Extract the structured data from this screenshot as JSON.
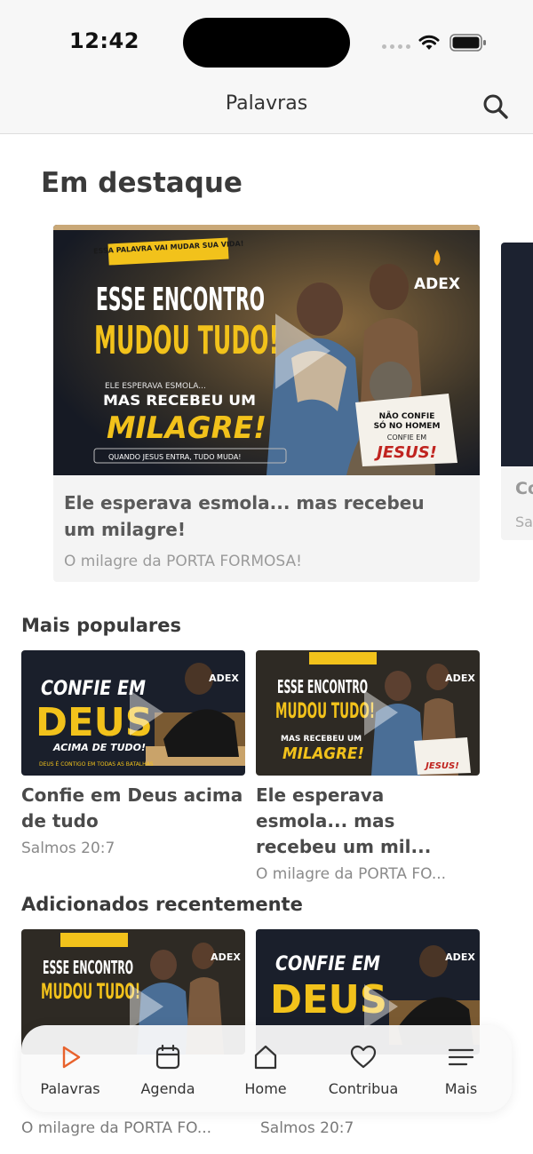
{
  "status": {
    "time": "12:42"
  },
  "header": {
    "title": "Palavras"
  },
  "featured": {
    "heading": "Em destaque",
    "item": {
      "title": "Ele esperava esmola... mas recebeu um milagre!",
      "subtitle": "O milagre da PORTA FORMOSA!"
    },
    "peek": {
      "title": "Co",
      "subtitle": "Sa"
    }
  },
  "popular": {
    "heading": "Mais populares",
    "items": [
      {
        "title": "Confie em Deus acima de tudo",
        "subtitle": "Salmos 20:7"
      },
      {
        "title": "Ele esperava esmola... mas recebeu um mil...",
        "subtitle": "O milagre da PORTA FO..."
      }
    ]
  },
  "recent": {
    "heading": "Adicionados recentemente",
    "items": [
      {
        "subtitle": "O milagre da PORTA FO..."
      },
      {
        "subtitle": "Salmos 20:7"
      }
    ]
  },
  "thumbs": {
    "milagre": {
      "banner": "ESSA PALAVRA VAI MUDAR SUA VIDA!",
      "line1": "ESSE ENCONTRO",
      "line2": "MUDOU TUDO!",
      "pre": "ELE ESPERAVA ESMOLA...",
      "mid": "MAS RECEBEU UM",
      "big": "MILAGRE!",
      "footer": "QUANDO JESUS ENTRA, TUDO MUDA!",
      "note1": "NÃO CONFIE",
      "note2": "SÓ NO HOMEM",
      "note3": "CONFIE EM",
      "note4": "JESUS!",
      "brand": "ADEX"
    },
    "confie": {
      "line1": "CONFIE EM",
      "line2": "DEUS",
      "line3": "ACIMA DE TUDO!",
      "footer": "DEUS É CONTIGO EM TODAS AS BATALHAS",
      "brand": "ADEX"
    }
  },
  "tabs": [
    {
      "label": "Palavras",
      "icon": "play-icon",
      "active": true
    },
    {
      "label": "Agenda",
      "icon": "calendar-icon"
    },
    {
      "label": "Home",
      "icon": "home-icon"
    },
    {
      "label": "Contribua",
      "icon": "heart-icon"
    },
    {
      "label": "Mais",
      "icon": "menu-icon"
    }
  ],
  "colors": {
    "accent": "#e8622c",
    "thumb_gold": "#f2c21b",
    "thumb_dark": "#1a1f2b"
  }
}
